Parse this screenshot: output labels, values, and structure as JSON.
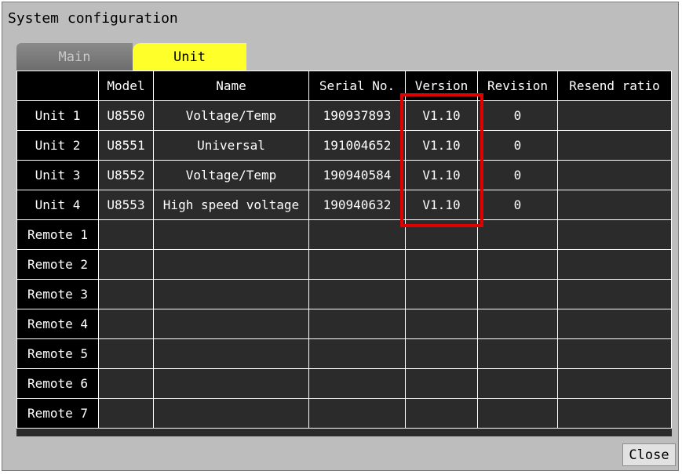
{
  "window": {
    "title": "System configuration"
  },
  "tabs": [
    {
      "label": "Main",
      "active": false
    },
    {
      "label": "Unit",
      "active": true
    }
  ],
  "table": {
    "headers": [
      "Model",
      "Name",
      "Serial No.",
      "Version",
      "Revision",
      "Resend ratio"
    ],
    "rows": [
      {
        "label": "Unit 1",
        "model": "U8550",
        "name": "Voltage/Temp",
        "serial": "190937893",
        "version": "V1.10",
        "revision": "0",
        "resend": ""
      },
      {
        "label": "Unit 2",
        "model": "U8551",
        "name": "Universal",
        "serial": "191004652",
        "version": "V1.10",
        "revision": "0",
        "resend": ""
      },
      {
        "label": "Unit 3",
        "model": "U8552",
        "name": "Voltage/Temp",
        "serial": "190940584",
        "version": "V1.10",
        "revision": "0",
        "resend": ""
      },
      {
        "label": "Unit 4",
        "model": "U8553",
        "name": "High speed voltage",
        "serial": "190940632",
        "version": "V1.10",
        "revision": "0",
        "resend": ""
      },
      {
        "label": "Remote 1",
        "model": "",
        "name": "",
        "serial": "",
        "version": "",
        "revision": "",
        "resend": ""
      },
      {
        "label": "Remote 2",
        "model": "",
        "name": "",
        "serial": "",
        "version": "",
        "revision": "",
        "resend": ""
      },
      {
        "label": "Remote 3",
        "model": "",
        "name": "",
        "serial": "",
        "version": "",
        "revision": "",
        "resend": ""
      },
      {
        "label": "Remote 4",
        "model": "",
        "name": "",
        "serial": "",
        "version": "",
        "revision": "",
        "resend": ""
      },
      {
        "label": "Remote 5",
        "model": "",
        "name": "",
        "serial": "",
        "version": "",
        "revision": "",
        "resend": ""
      },
      {
        "label": "Remote 6",
        "model": "",
        "name": "",
        "serial": "",
        "version": "",
        "revision": "",
        "resend": ""
      },
      {
        "label": "Remote 7",
        "model": "",
        "name": "",
        "serial": "",
        "version": "",
        "revision": "",
        "resend": ""
      }
    ]
  },
  "footer": {
    "close_label": "Close"
  },
  "colors": {
    "window_bg": "#bdbdbd",
    "active_tab": "#ffff2a",
    "inactive_tab": "#7a7a7a",
    "panel_bg": "#2b2b2b",
    "header_bg": "#000000",
    "highlight": "#e00000"
  }
}
